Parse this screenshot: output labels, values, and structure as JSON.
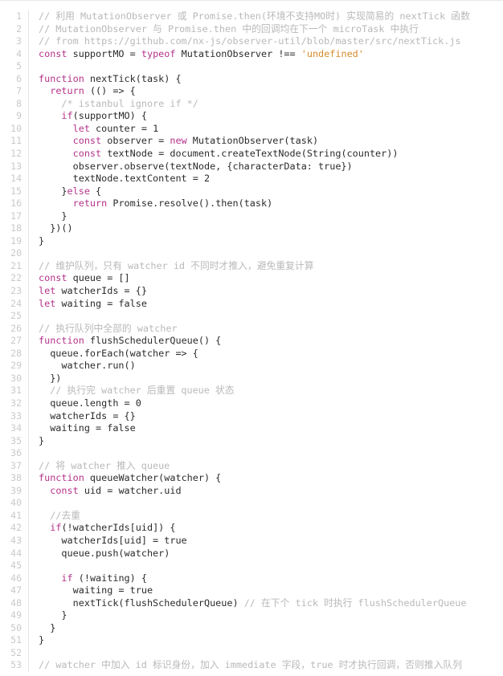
{
  "document": {
    "kind": "code-listing",
    "language": "javascript",
    "line_count": 53,
    "first_line_number": 1,
    "colors": {
      "background": "#ffffff",
      "text": "#2b2b2b",
      "comment": "#b9b9b9",
      "keyword": "#b5338a",
      "string": "#d38b2a",
      "line_number": "#c9c9c9",
      "gutter_border": "#e4e4e4",
      "top_border": "#e8e8e8"
    }
  },
  "line_numbers": [
    "1",
    "2",
    "3",
    "4",
    "5",
    "6",
    "7",
    "8",
    "9",
    "10",
    "11",
    "12",
    "13",
    "14",
    "15",
    "16",
    "17",
    "18",
    "19",
    "20",
    "21",
    "22",
    "23",
    "24",
    "25",
    "26",
    "27",
    "28",
    "29",
    "30",
    "31",
    "32",
    "33",
    "34",
    "35",
    "36",
    "37",
    "38",
    "39",
    "40",
    "41",
    "42",
    "43",
    "44",
    "45",
    "46",
    "47",
    "48",
    "49",
    "50",
    "51",
    "52",
    "53"
  ],
  "code": {
    "plain_text": [
      "// 利用 MutationObserver 或 Promise.then(环境不支持MO时) 实现简易的 nextTick 函数",
      "// MutationObserver 与 Promise.then 中的回调均在下一个 microTask 中执行",
      "// from https://github.com/nx-js/observer-util/blob/master/src/nextTick.js",
      "const supportMO = typeof MutationObserver !== 'undefined'",
      "",
      "function nextTick(task) {",
      "  return (() => {",
      "    /* istanbul ignore if */",
      "    if(supportMO) {",
      "      let counter = 1",
      "      const observer = new MutationObserver(task)",
      "      const textNode = document.createTextNode(String(counter))",
      "      observer.observe(textNode, {characterData: true})",
      "      textNode.textContent = 2",
      "    }else {",
      "      return Promise.resolve().then(task)",
      "    }",
      "  })()",
      "}",
      "",
      "// 维护队列，只有 watcher id 不同时才推入，避免重复计算",
      "const queue = []",
      "let watcherIds = {}",
      "let waiting = false",
      "",
      "// 执行队列中全部的 watcher",
      "function flushSchedulerQueue() {",
      "  queue.forEach(watcher => {",
      "    watcher.run()",
      "  })",
      "  // 执行完 watcher 后重置 queue 状态",
      "  queue.length = 0",
      "  watcherIds = {}",
      "  waiting = false",
      "}",
      "",
      "// 将 watcher 推入 queue",
      "function queueWatcher(watcher) {",
      "  const uid = watcher.uid",
      "",
      "  //去重",
      "  if(!watcherIds[uid]) {",
      "    watcherIds[uid] = true",
      "    queue.push(watcher)",
      "",
      "    if (!waiting) {",
      "      waiting = true",
      "      nextTick(flushSchedulerQueue) // 在下个 tick 时执行 flushSchedulerQueue",
      "    }",
      "  }",
      "}",
      "",
      "// watcher 中加入 id 标识身份，加入 immediate 字段，true 时才执行回调，否则推入队列"
    ],
    "tokens": [
      [
        [
          "com",
          "// "
        ],
        [
          "com-cjk",
          "利用"
        ],
        [
          "com",
          " MutationObserver "
        ],
        [
          "com-cjk",
          "或"
        ],
        [
          "com",
          " Promise.then("
        ],
        [
          "com-cjk",
          "环境不支持"
        ],
        [
          "com",
          "MO"
        ],
        [
          "com-cjk",
          "时"
        ],
        [
          "com",
          ") "
        ],
        [
          "com-cjk",
          "实现简易的"
        ],
        [
          "com",
          " nextTick "
        ],
        [
          "com-cjk",
          "函数"
        ]
      ],
      [
        [
          "com",
          "// MutationObserver "
        ],
        [
          "com-cjk",
          "与"
        ],
        [
          "com",
          " Promise.then "
        ],
        [
          "com-cjk",
          "中的回调均在下一个"
        ],
        [
          "com",
          " microTask "
        ],
        [
          "com-cjk",
          "中执行"
        ]
      ],
      [
        [
          "com",
          "// from https://github.com/nx-js/observer-util/blob/master/src/nextTick.js"
        ]
      ],
      [
        [
          "kw",
          "const"
        ],
        [
          "pln",
          " supportMO = "
        ],
        [
          "kw",
          "typeof"
        ],
        [
          "pln",
          " MutationObserver !== "
        ],
        [
          "str",
          "'undefined'"
        ]
      ],
      [
        [
          "pln",
          ""
        ]
      ],
      [
        [
          "kw",
          "function"
        ],
        [
          "pln",
          " nextTick(task) {"
        ]
      ],
      [
        [
          "pln",
          "  "
        ],
        [
          "kw",
          "return"
        ],
        [
          "pln",
          " (() => {"
        ]
      ],
      [
        [
          "pln",
          "    "
        ],
        [
          "com",
          "/* istanbul ignore if */"
        ]
      ],
      [
        [
          "pln",
          "    "
        ],
        [
          "kw",
          "if"
        ],
        [
          "pln",
          "(supportMO) {"
        ]
      ],
      [
        [
          "pln",
          "      "
        ],
        [
          "kw",
          "let"
        ],
        [
          "pln",
          " counter = 1"
        ]
      ],
      [
        [
          "pln",
          "      "
        ],
        [
          "kw",
          "const"
        ],
        [
          "pln",
          " observer = "
        ],
        [
          "kw",
          "new"
        ],
        [
          "pln",
          " MutationObserver(task)"
        ]
      ],
      [
        [
          "pln",
          "      "
        ],
        [
          "kw",
          "const"
        ],
        [
          "pln",
          " textNode = document.createTextNode(String(counter))"
        ]
      ],
      [
        [
          "pln",
          "      observer.observe(textNode, {characterData: true})"
        ]
      ],
      [
        [
          "pln",
          "      textNode.textContent = 2"
        ]
      ],
      [
        [
          "pln",
          "    }"
        ],
        [
          "kw",
          "else"
        ],
        [
          "pln",
          " {"
        ]
      ],
      [
        [
          "pln",
          "      "
        ],
        [
          "kw",
          "return"
        ],
        [
          "pln",
          " Promise.resolve().then(task)"
        ]
      ],
      [
        [
          "pln",
          "    }"
        ]
      ],
      [
        [
          "pln",
          "  })()"
        ]
      ],
      [
        [
          "pln",
          "}"
        ]
      ],
      [
        [
          "pln",
          ""
        ]
      ],
      [
        [
          "com",
          "// "
        ],
        [
          "com-cjk",
          "维护队列，只有"
        ],
        [
          "com",
          " watcher id "
        ],
        [
          "com-cjk",
          "不同时才推入，避免重复计算"
        ]
      ],
      [
        [
          "kw",
          "const"
        ],
        [
          "pln",
          " queue = []"
        ]
      ],
      [
        [
          "kw",
          "let"
        ],
        [
          "pln",
          " watcherIds = {}"
        ]
      ],
      [
        [
          "kw",
          "let"
        ],
        [
          "pln",
          " waiting = false"
        ]
      ],
      [
        [
          "pln",
          ""
        ]
      ],
      [
        [
          "com",
          "// "
        ],
        [
          "com-cjk",
          "执行队列中全部的"
        ],
        [
          "com",
          " watcher"
        ]
      ],
      [
        [
          "kw",
          "function"
        ],
        [
          "pln",
          " flushSchedulerQueue() {"
        ]
      ],
      [
        [
          "pln",
          "  queue.forEach(watcher => {"
        ]
      ],
      [
        [
          "pln",
          "    watcher.run()"
        ]
      ],
      [
        [
          "pln",
          "  })"
        ]
      ],
      [
        [
          "pln",
          "  "
        ],
        [
          "com",
          "// "
        ],
        [
          "com-cjk",
          "执行完"
        ],
        [
          "com",
          " watcher "
        ],
        [
          "com-cjk",
          "后重置"
        ],
        [
          "com",
          " queue "
        ],
        [
          "com-cjk",
          "状态"
        ]
      ],
      [
        [
          "pln",
          "  queue.length = 0"
        ]
      ],
      [
        [
          "pln",
          "  watcherIds = {}"
        ]
      ],
      [
        [
          "pln",
          "  waiting = false"
        ]
      ],
      [
        [
          "pln",
          "}"
        ]
      ],
      [
        [
          "pln",
          ""
        ]
      ],
      [
        [
          "com",
          "// "
        ],
        [
          "com-cjk",
          "将"
        ],
        [
          "com",
          " watcher "
        ],
        [
          "com-cjk",
          "推入"
        ],
        [
          "com",
          " queue"
        ]
      ],
      [
        [
          "kw",
          "function"
        ],
        [
          "pln",
          " queueWatcher(watcher) {"
        ]
      ],
      [
        [
          "pln",
          "  "
        ],
        [
          "kw",
          "const"
        ],
        [
          "pln",
          " uid = watcher.uid"
        ]
      ],
      [
        [
          "pln",
          ""
        ]
      ],
      [
        [
          "pln",
          "  "
        ],
        [
          "com",
          "//"
        ],
        [
          "com-cjk",
          "去重"
        ]
      ],
      [
        [
          "pln",
          "  "
        ],
        [
          "kw",
          "if"
        ],
        [
          "pln",
          "(!watcherIds[uid]) {"
        ]
      ],
      [
        [
          "pln",
          "    watcherIds[uid] = true"
        ]
      ],
      [
        [
          "pln",
          "    queue.push(watcher)"
        ]
      ],
      [
        [
          "pln",
          ""
        ]
      ],
      [
        [
          "pln",
          "    "
        ],
        [
          "kw",
          "if"
        ],
        [
          "pln",
          " (!waiting) {"
        ]
      ],
      [
        [
          "pln",
          "      waiting = true"
        ]
      ],
      [
        [
          "pln",
          "      nextTick(flushSchedulerQueue) "
        ],
        [
          "com",
          "// "
        ],
        [
          "com-cjk",
          "在下个"
        ],
        [
          "com",
          " tick "
        ],
        [
          "com-cjk",
          "时执行"
        ],
        [
          "com",
          " flushSchedulerQueue"
        ]
      ],
      [
        [
          "pln",
          "    }"
        ]
      ],
      [
        [
          "pln",
          "  }"
        ]
      ],
      [
        [
          "pln",
          "}"
        ]
      ],
      [
        [
          "pln",
          ""
        ]
      ],
      [
        [
          "com",
          "// watcher "
        ],
        [
          "com-cjk",
          "中加入"
        ],
        [
          "com",
          " id "
        ],
        [
          "com-cjk",
          "标识身份，加入"
        ],
        [
          "com",
          " immediate "
        ],
        [
          "com-cjk",
          "字段，"
        ],
        [
          "com",
          "true "
        ],
        [
          "com-cjk",
          "时才执行回调，否则推入队列"
        ]
      ]
    ]
  }
}
